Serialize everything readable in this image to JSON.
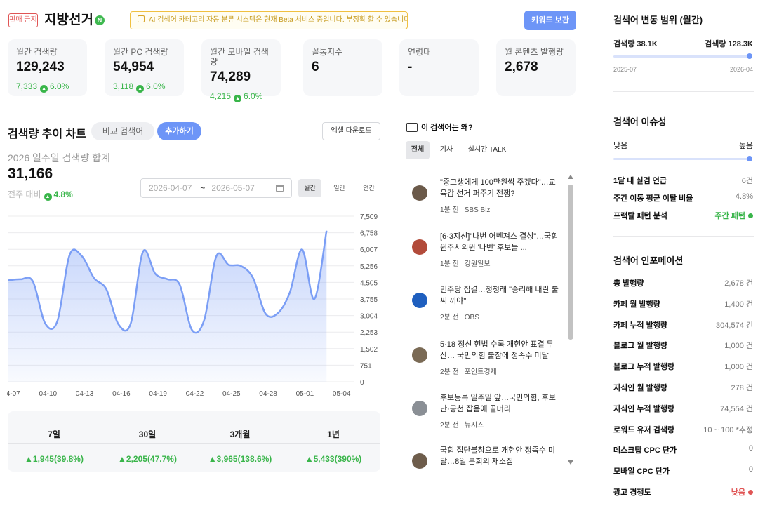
{
  "header": {
    "ban_badge": "판매 금지",
    "keyword": "지방선거",
    "naver_badge": "N",
    "notice": "AI 검색어 카테고리 자동 분류 시스템은 현재 Beta 서비스 중입니다. 부정확 할 수 있습니다.",
    "save_button": "키워드 보관"
  },
  "stats": [
    {
      "label": "월간 검색량",
      "value": "129,243",
      "delta": "7,333",
      "pct": "6.0%"
    },
    {
      "label": "월간 PC 검색량",
      "value": "54,954",
      "delta": "3,118",
      "pct": "6.0%"
    },
    {
      "label": "월간 모바일 검색량",
      "value": "74,289",
      "delta": "4,215",
      "pct": "6.0%"
    },
    {
      "label": "꼴통지수",
      "value": "6",
      "delta": "",
      "pct": ""
    },
    {
      "label": "연령대",
      "value": "-",
      "delta": "",
      "pct": ""
    },
    {
      "label": "월 콘텐츠 발행량",
      "value": "2,678",
      "delta": "",
      "pct": ""
    }
  ],
  "chart_section": {
    "title": "검색량 추이 차트",
    "compare_placeholder": "비교 검색어",
    "add_button": "추가하기",
    "excel_button": "엑셀 다운로드",
    "sum_label": "2026 일주일 검색량 합계",
    "sum_value": "31,166",
    "wow_label": "전주 대비",
    "wow_pct": "4.8%",
    "date_from": "2026-04-07",
    "date_sep": "~",
    "date_to": "2026-05-07",
    "periods": [
      "월간",
      "일간",
      "연간"
    ]
  },
  "chart_data": {
    "type": "area",
    "x": [
      "04-07",
      "04-08",
      "04-09",
      "04-10",
      "04-11",
      "04-12",
      "04-13",
      "04-14",
      "04-15",
      "04-16",
      "04-17",
      "04-18",
      "04-19",
      "04-20",
      "04-21",
      "04-22",
      "04-23",
      "04-24",
      "04-25",
      "04-26",
      "04-27",
      "04-28",
      "04-29",
      "04-30",
      "05-01",
      "05-02",
      "05-03",
      "05-04",
      "05-05",
      "05-06",
      "05-07"
    ],
    "values": [
      4600,
      4650,
      4550,
      2650,
      2750,
      5750,
      5700,
      4700,
      4200,
      2600,
      2650,
      5900,
      4900,
      4650,
      4400,
      2350,
      2800,
      5700,
      5300,
      5250,
      4700,
      3100,
      3100,
      4050,
      6000,
      3750,
      6850
    ],
    "xticks": [
      "04-07",
      "04-10",
      "04-13",
      "04-16",
      "04-19",
      "04-22",
      "04-25",
      "04-28",
      "05-01",
      "05-04"
    ],
    "yticks": [
      "0",
      "751",
      "1,502",
      "2,253",
      "3,004",
      "3,755",
      "4,505",
      "5,256",
      "6,007",
      "6,758",
      "7,509"
    ],
    "ylim": [
      0,
      7509
    ],
    "grid": true,
    "color": "#7b9ef5"
  },
  "period_table": {
    "headers": [
      "7일",
      "30일",
      "3개월",
      "1년"
    ],
    "values": [
      "▲1,945(39.8%)",
      "▲2,205(47.7%)",
      "▲3,965(138.6%)",
      "▲5,433(390%)"
    ]
  },
  "news": {
    "title": "이 검색어는 왜?",
    "tabs": [
      "전체",
      "기사",
      "실시간 TALK"
    ],
    "items": [
      {
        "title": "\"중고생에게 100만원씩 주겠다\"…교육감 선거 퍼주기 전쟁?",
        "time": "1분 전",
        "source": "SBS Biz",
        "thumb": "#6b5a4a"
      },
      {
        "title": "[6·3지선]\"나번 어벤져스 결성\"…국힘 원주시의원 '나번' 후보들 ...",
        "time": "1분 전",
        "source": "강원일보",
        "thumb": "#b24b3a"
      },
      {
        "title": "민주당 집결…정청래 \"승리해 내란 불씨 꺼야\"",
        "time": "2분 전",
        "source": "OBS",
        "thumb": "#1f5fbf"
      },
      {
        "title": "5·18 정신 헌법 수록 개헌안 표결 무산… 국민의힘 불참에 정족수 미달",
        "time": "2분 전",
        "source": "포인트경제",
        "thumb": "#7a6a55"
      },
      {
        "title": "후보등록 일주일 앞…국민의힘, 후보난·공천 잡음에 골머리",
        "time": "2분 전",
        "source": "뉴시스",
        "thumb": "#8a8f95"
      },
      {
        "title": "국힘 집단불참으로 개헌안 정족수 미달…8일 본회의 재소집",
        "time": "",
        "source": "",
        "thumb": "#6e5d4c"
      }
    ]
  },
  "range_panel": {
    "title": "검색어 변동 범위 (월간)",
    "min_label": "검색량 38.1K",
    "max_label": "검색량 128.3K",
    "start_date": "2025-07",
    "end_date": "2026-04",
    "level": 1.0
  },
  "issue_panel": {
    "title": "검색어 이슈성",
    "low": "낮음",
    "high": "높음",
    "level": 1.0,
    "rows": [
      {
        "key": "1달 내 실검 언급",
        "value": "6건"
      },
      {
        "key": "주간 이동 평균 이탈 비율",
        "value": "4.8%"
      },
      {
        "key": "프랙탈 패턴 분석",
        "value": "주간 패턴"
      }
    ]
  },
  "info_panel": {
    "title": "검색어 인포메이션",
    "rows": [
      {
        "key": "총 발행량",
        "value": "2,678 건"
      },
      {
        "key": "카페 월 발행량",
        "value": "1,400 건"
      },
      {
        "key": "카페 누적 발행량",
        "value": "304,574 건"
      },
      {
        "key": "블로그 월 발행량",
        "value": "1,000 건"
      },
      {
        "key": "블로그 누적 발행량",
        "value": "1,000 건"
      },
      {
        "key": "지식인 월 발행량",
        "value": "278 건"
      },
      {
        "key": "지식인 누적 발행량",
        "value": "74,554 건"
      },
      {
        "key": "로워드 유저 검색량",
        "value": "10 ~ 100 *추정"
      },
      {
        "key": "데스크탑 CPC 단가",
        "value": "0"
      },
      {
        "key": "모바일 CPC 단가",
        "value": "0"
      },
      {
        "key": "광고 경쟁도",
        "value": "낮음"
      }
    ]
  },
  "colors": {
    "accent": "#6d95f7",
    "positive": "#39b54a",
    "negative": "#e05555",
    "warning": "#f0c040"
  }
}
